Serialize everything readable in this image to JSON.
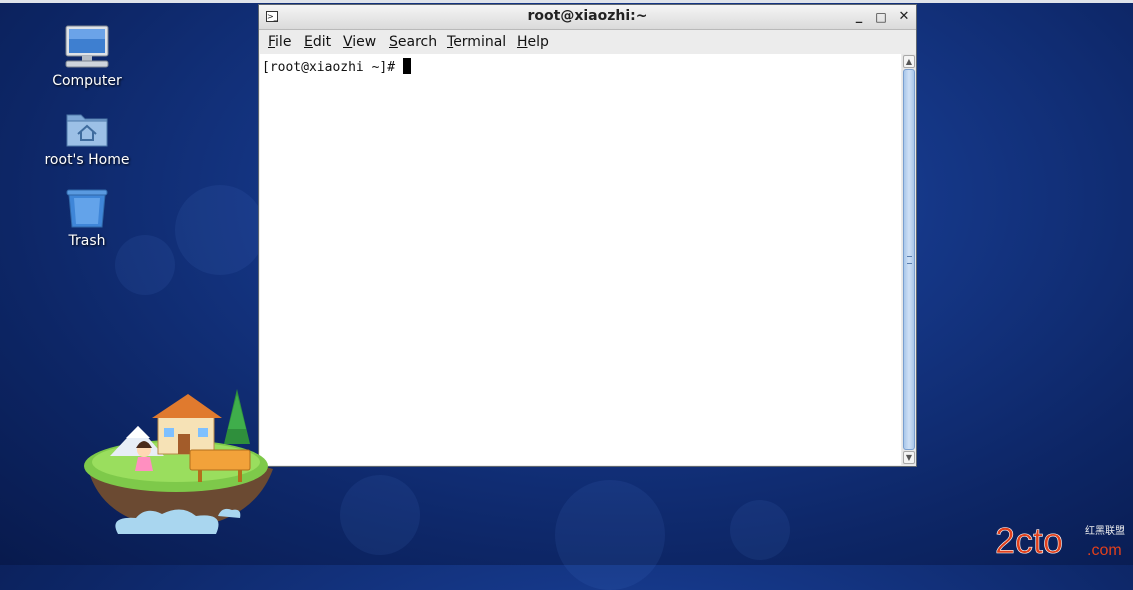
{
  "desktop": {
    "icons": [
      {
        "label": "Computer",
        "icon": "computer-icon"
      },
      {
        "label": "root's Home",
        "icon": "home-folder-icon"
      },
      {
        "label": "Trash",
        "icon": "trash-icon"
      }
    ]
  },
  "window": {
    "title": "root@xiaozhi:~",
    "buttons": {
      "minimize": "_",
      "maximize": "□",
      "close": "✕"
    },
    "menu": [
      {
        "mnemonic": "F",
        "rest": "ile"
      },
      {
        "mnemonic": "E",
        "rest": "dit"
      },
      {
        "mnemonic": "V",
        "rest": "iew"
      },
      {
        "mnemonic": "S",
        "rest": "earch"
      },
      {
        "mnemonic": "T",
        "rest": "erminal"
      },
      {
        "mnemonic": "H",
        "rest": "elp"
      }
    ],
    "terminal": {
      "prompt": "[root@xiaozhi ~]#"
    }
  },
  "watermark": {
    "text": "2cto",
    "suffix": ".com",
    "sub": "红黑联盟"
  },
  "colors": {
    "desktop_bg": "#153787",
    "scroll_thumb": "#a9c7ea",
    "watermark": "#e0401c"
  }
}
